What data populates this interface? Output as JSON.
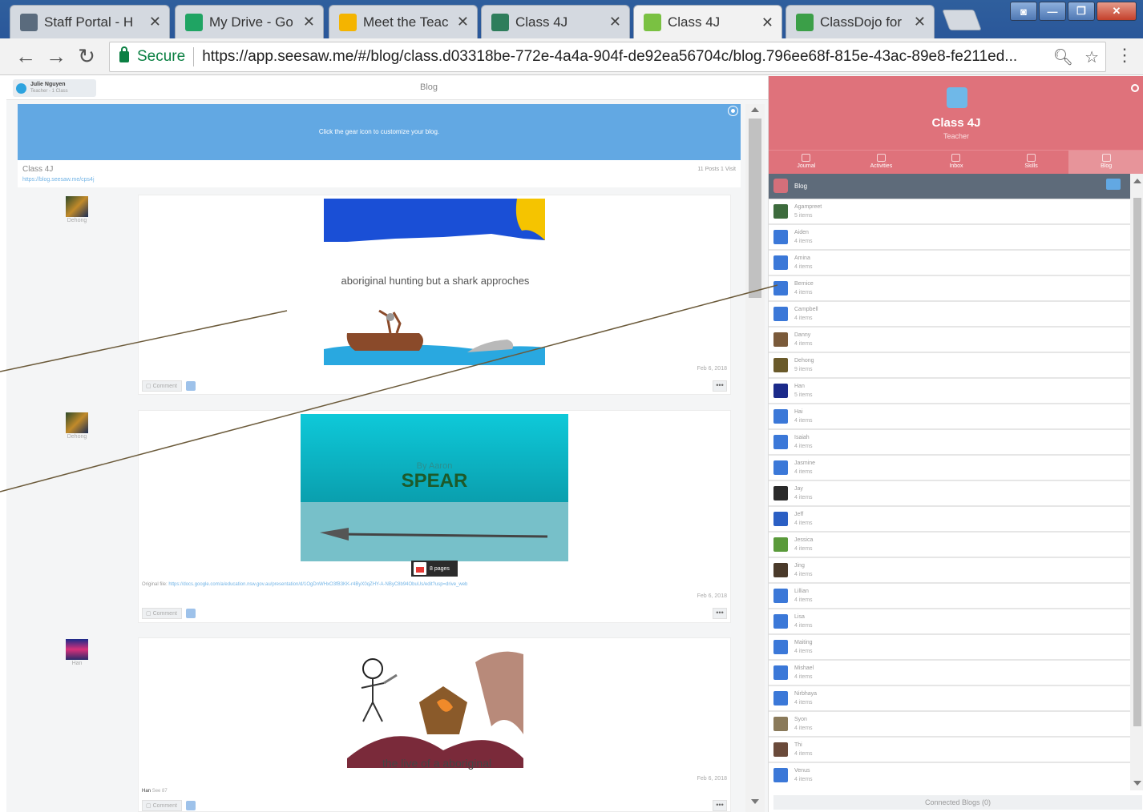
{
  "browser": {
    "tabs": [
      {
        "title": "Staff Portal - H",
        "icon": "nsw-icon",
        "color": "#5a6b7d"
      },
      {
        "title": "My Drive - Go",
        "icon": "google-drive-icon",
        "color": "#1fa463"
      },
      {
        "title": "Meet the Teac",
        "icon": "slides-icon",
        "color": "#f4b400"
      },
      {
        "title": "Class 4J",
        "icon": "seesaw-icon",
        "color": "#2e7d5b"
      },
      {
        "title": "Class 4J",
        "icon": "seesaw-green-icon",
        "color": "#7ac142"
      },
      {
        "title": "ClassDojo for",
        "icon": "classdojo-icon",
        "color": "#3b9f48"
      }
    ],
    "secure_label": "Secure",
    "url": "https://app.seesaw.me/#/blog/class.d03318be-772e-4a4a-904f-de92ea56704c/blog.796ee68f-815e-43ac-89e8-fe211ed..."
  },
  "page": {
    "title": "Blog",
    "user": {
      "name": "Julie Nguyen",
      "role": "Teacher - 1 Class"
    },
    "banner_text": "Click the gear icon to customize your blog.",
    "class_name": "Class 4J",
    "class_link": "https://blog.seesaw.me/cps4j",
    "stats": "11 Posts   1 Visit"
  },
  "posts": [
    {
      "author": "Dehong",
      "caption": "aboriginal hunting but a shark approches",
      "date": "Feb 6, 2018",
      "comment_label": "Comment"
    },
    {
      "author": "Dehong",
      "image_title": "SPEAR",
      "image_subtitle": "By Aaron",
      "pages_label": "8 pages",
      "original_file_label": "Original file:",
      "original_file_link": "https://docs.google.com/a/education.nsw.gov.au/presentation/d/1OgDnWHxO3fB3KK-r4ByX0qZHY-A-NByC8b94ObuUs/edit?usp=drive_web",
      "date": "Feb 6, 2018",
      "comment_label": "Comment"
    },
    {
      "author": "Han",
      "caption": "the live of a aboriginal",
      "tag_name": "Han",
      "tag_detail": "See 87",
      "date": "Feb 6, 2018",
      "comment_label": "Comment"
    }
  ],
  "sidebar": {
    "class_title": "Class 4J",
    "role": "Teacher",
    "tabs": [
      "Journal",
      "Activities",
      "Inbox",
      "Skills",
      "Blog"
    ],
    "active_tab": "Blog",
    "blog_label": "Blog",
    "students": [
      {
        "name": "Agampreet",
        "count": "5 items",
        "color": "#3d6b3d"
      },
      {
        "name": "Aiden",
        "count": "4 items",
        "color": "#3b78d8"
      },
      {
        "name": "Amina",
        "count": "4 items",
        "color": "#3b78d8"
      },
      {
        "name": "Bernice",
        "count": "4 items",
        "color": "#3b78d8"
      },
      {
        "name": "Campbell",
        "count": "4 items",
        "color": "#3b78d8"
      },
      {
        "name": "Danny",
        "count": "4 items",
        "color": "#7a5a3a"
      },
      {
        "name": "Dehong",
        "count": "9 items",
        "color": "#6a5a2a"
      },
      {
        "name": "Han",
        "count": "5 items",
        "color": "#1b2a8a"
      },
      {
        "name": "Hai",
        "count": "4 items",
        "color": "#3b78d8"
      },
      {
        "name": "Isaiah",
        "count": "4 items",
        "color": "#3b78d8"
      },
      {
        "name": "Jasmine",
        "count": "4 items",
        "color": "#3b78d8"
      },
      {
        "name": "Jay",
        "count": "4 items",
        "color": "#2a2a2a"
      },
      {
        "name": "Jeff",
        "count": "4 items",
        "color": "#2b5fc4"
      },
      {
        "name": "Jessica",
        "count": "4 items",
        "color": "#5a9a3a"
      },
      {
        "name": "Jing",
        "count": "4 items",
        "color": "#4a3a2a"
      },
      {
        "name": "Lillian",
        "count": "4 items",
        "color": "#3b78d8"
      },
      {
        "name": "Lisa",
        "count": "4 items",
        "color": "#3b78d8"
      },
      {
        "name": "Maiting",
        "count": "4 items",
        "color": "#3b78d8"
      },
      {
        "name": "Mishael",
        "count": "4 items",
        "color": "#3b78d8"
      },
      {
        "name": "Nirbhaya",
        "count": "4 items",
        "color": "#3b78d8"
      },
      {
        "name": "Syon",
        "count": "4 items",
        "color": "#8a7a5a"
      },
      {
        "name": "Thi",
        "count": "4 items",
        "color": "#6a4a3a"
      },
      {
        "name": "Venus",
        "count": "4 items",
        "color": "#3b78d8"
      }
    ],
    "connected_blogs": "Connected Blogs (0)"
  },
  "colors": {
    "header": "#df727b",
    "banner": "#62a8e3",
    "annotation_line": "#6b5a3a"
  }
}
